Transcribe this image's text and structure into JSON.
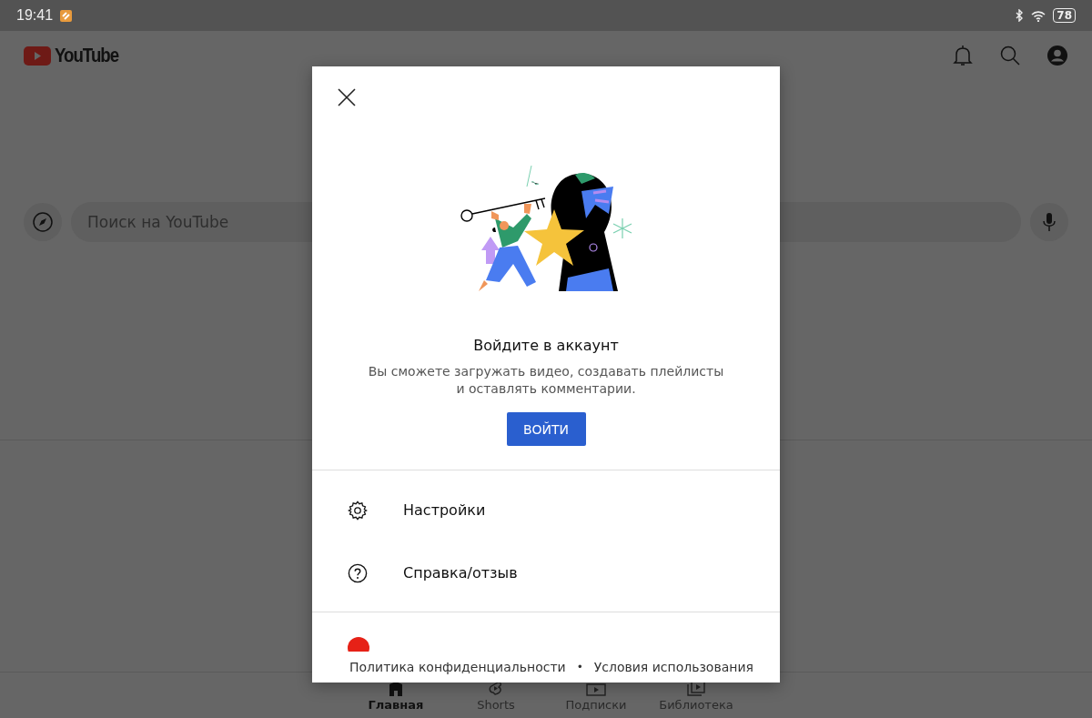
{
  "status_bar": {
    "time": "19:41",
    "battery": "78"
  },
  "app_bar": {
    "logo": "YouTube"
  },
  "search": {
    "placeholder": "Поиск на YouTube"
  },
  "bottom_nav": [
    {
      "label": "Главная",
      "kind": "home",
      "selected": true
    },
    {
      "label": "Shorts",
      "kind": "shorts",
      "selected": false
    },
    {
      "label": "Подписки",
      "kind": "subscriptions",
      "selected": false
    },
    {
      "label": "Библиотека",
      "kind": "library",
      "selected": false
    }
  ],
  "dialog": {
    "title": "Войдите в аккаунт",
    "description": "Вы сможете загружать видео, создавать плейлисты и оставлять комментарии.",
    "sign_in_button": "ВОЙТИ",
    "menu": [
      {
        "label": "Настройки",
        "kind": "settings"
      },
      {
        "label": "Справка/отзыв",
        "kind": "help"
      }
    ],
    "footer_links": [
      "Политика конфиденциальности",
      "Условия использования"
    ],
    "footer_separator": "•"
  }
}
